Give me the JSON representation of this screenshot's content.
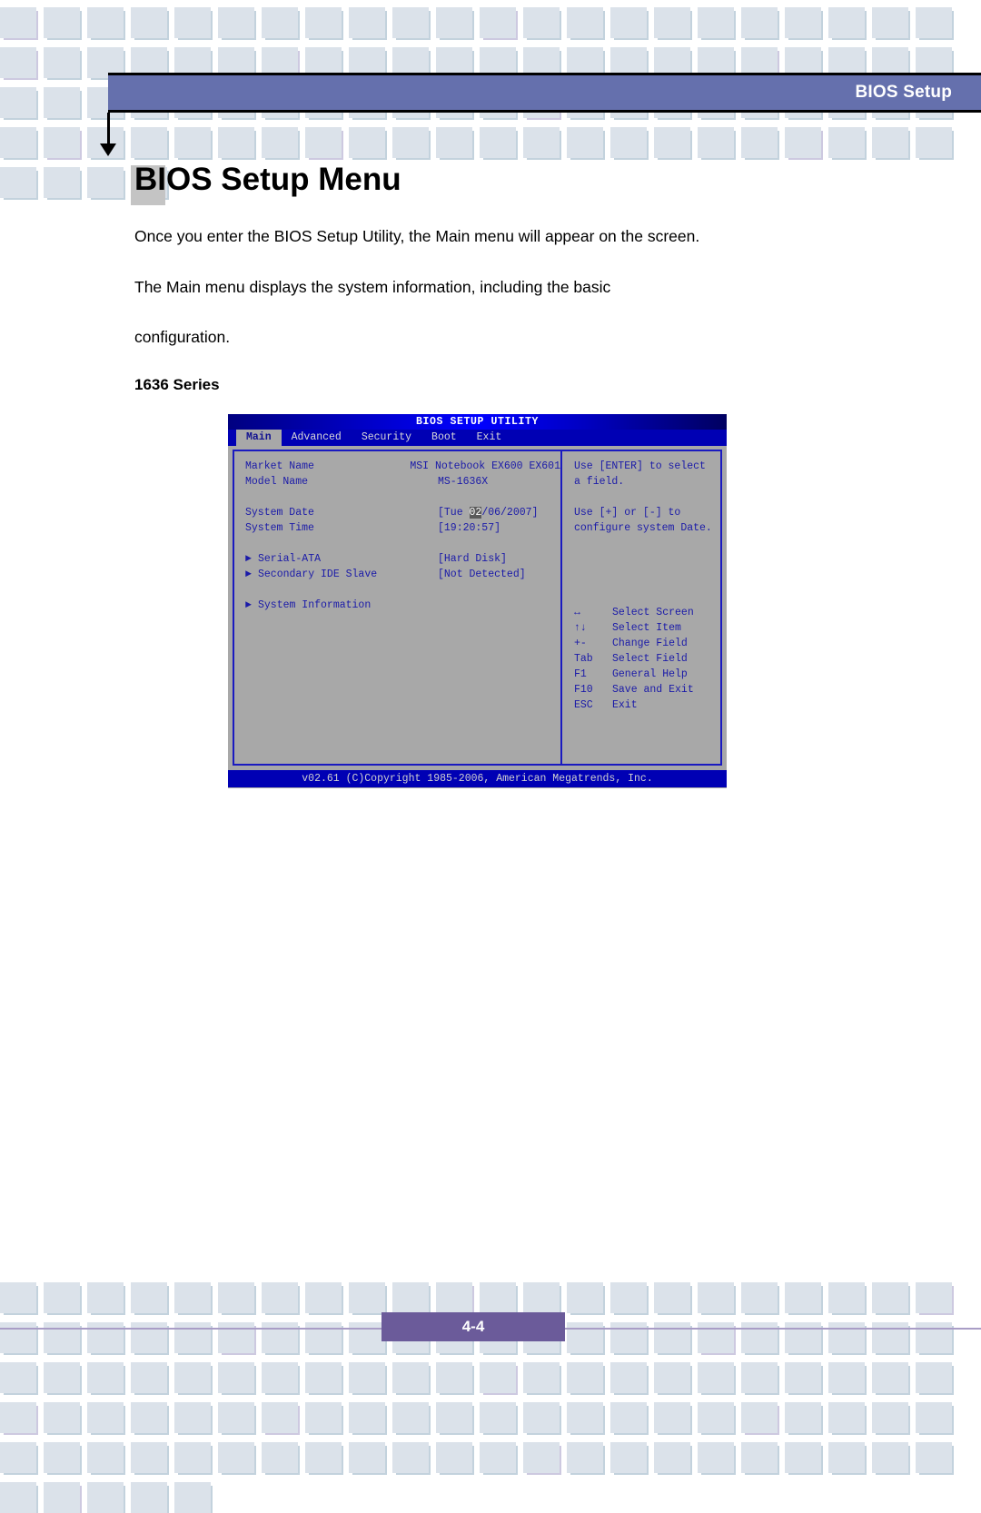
{
  "header": {
    "banner_title": "BIOS Setup"
  },
  "page": {
    "title": "BIOS Setup Menu",
    "paragraph_1": "Once you enter the BIOS Setup Utility, the Main menu will appear on the screen.",
    "paragraph_2": "The Main menu displays the system information, including the basic",
    "paragraph_3": "configuration.",
    "series_label": "1636 Series"
  },
  "bios": {
    "title": "BIOS SETUP UTILITY",
    "menu": [
      {
        "label": "Main",
        "active": true
      },
      {
        "label": "Advanced",
        "active": false
      },
      {
        "label": "Security",
        "active": false
      },
      {
        "label": "Boot",
        "active": false
      },
      {
        "label": "Exit",
        "active": false
      }
    ],
    "fields": {
      "market_name_label": "Market Name",
      "market_name_value": "MSI Notebook EX600 EX601",
      "model_name_label": "Model Name",
      "model_name_value": "MS-1636X",
      "system_date_label": "System Date",
      "system_date_prefix": "[Tue ",
      "system_date_highlight": "02",
      "system_date_suffix": "/06/2007]",
      "system_time_label": "System Time",
      "system_time_value": "[19:20:57]",
      "serial_ata_label": "Serial-ATA",
      "serial_ata_value": "[Hard Disk]",
      "secondary_ide_label": "Secondary IDE Slave",
      "secondary_ide_value": "[Not Detected]",
      "system_information_label": "System Information"
    },
    "help": {
      "line_1": "Use [ENTER] to select",
      "line_2": "a field.",
      "line_3": "Use [+] or [-] to",
      "line_4": "configure system Date."
    },
    "keys": [
      {
        "key": "↔",
        "desc": "Select Screen"
      },
      {
        "key": "↑↓",
        "desc": "Select Item"
      },
      {
        "key": "+-",
        "desc": "Change Field"
      },
      {
        "key": "Tab",
        "desc": "Select Field"
      },
      {
        "key": "F1",
        "desc": "General Help"
      },
      {
        "key": "F10",
        "desc": "Save and Exit"
      },
      {
        "key": "ESC",
        "desc": "Exit"
      }
    ],
    "copyright": "v02.61 (C)Copyright 1985-2006, American Megatrends, Inc."
  },
  "footer": {
    "page_number": "4-4"
  },
  "colors": {
    "banner": "#6570ad",
    "page_band": "#6b5b9a",
    "bios_bg": "#a8a8a8",
    "bios_blue": "#0000b4",
    "bios_text": "#1a1aa8",
    "square": "#dbe2ea"
  }
}
